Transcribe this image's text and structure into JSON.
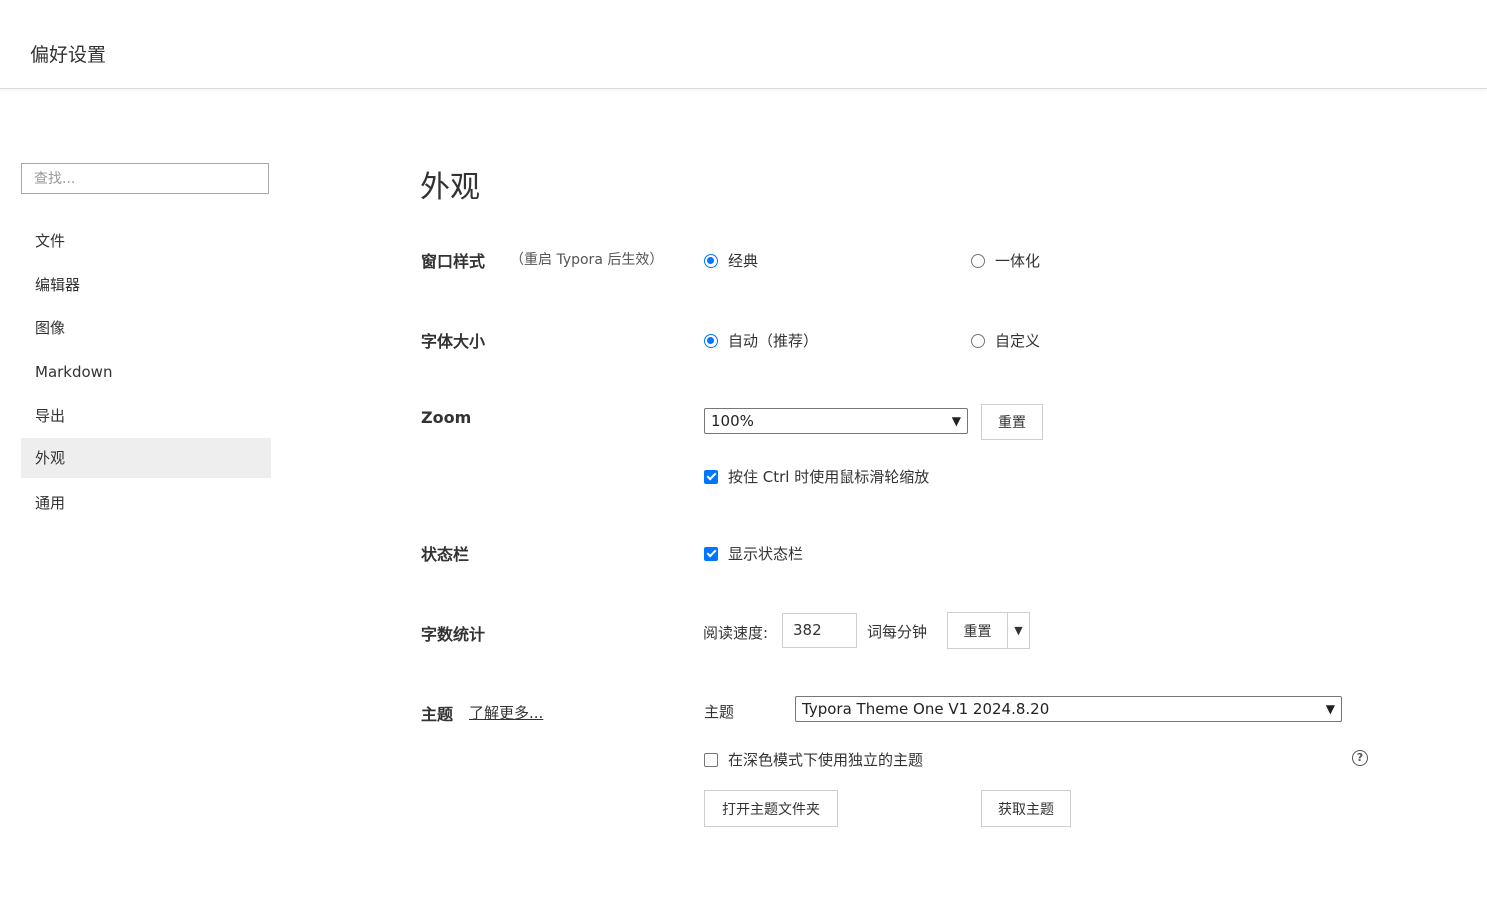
{
  "header": {
    "title": "偏好设置"
  },
  "sidebar": {
    "search_placeholder": "查找...",
    "items": [
      {
        "label": "文件"
      },
      {
        "label": "编辑器"
      },
      {
        "label": "图像"
      },
      {
        "label": "Markdown"
      },
      {
        "label": "导出"
      },
      {
        "label": "外观",
        "active": true
      },
      {
        "label": "通用"
      }
    ]
  },
  "main": {
    "title": "外观",
    "window_style": {
      "label": "窗口样式",
      "note": "（重启 Typora 后生效）",
      "options": [
        {
          "label": "经典",
          "checked": true
        },
        {
          "label": "一体化",
          "checked": false
        }
      ]
    },
    "font_size": {
      "label": "字体大小",
      "options": [
        {
          "label": "自动（推荐）",
          "checked": true
        },
        {
          "label": "自定义",
          "checked": false
        }
      ]
    },
    "zoom": {
      "label": "Zoom",
      "value": "100%",
      "reset_label": "重置",
      "ctrl_wheel_label": "按住 Ctrl 时使用鼠标滑轮缩放",
      "ctrl_wheel_checked": true
    },
    "status_bar": {
      "label": "状态栏",
      "show_label": "显示状态栏",
      "show_checked": true
    },
    "word_count": {
      "label": "字数统计",
      "speed_label": "阅读速度:",
      "speed_value": "382",
      "unit": "词每分钟",
      "reset_label": "重置"
    },
    "theme": {
      "label": "主题",
      "learn_more": "了解更多...",
      "select_label": "主题",
      "value": "Typora Theme One V1 2024.8.20",
      "dark_mode_label": "在深色模式下使用独立的主题",
      "dark_mode_checked": false,
      "open_folder_label": "打开主题文件夹",
      "get_themes_label": "获取主题"
    }
  },
  "colors": {
    "accent": "#0075ff",
    "active_bg": "#eeeeee"
  }
}
